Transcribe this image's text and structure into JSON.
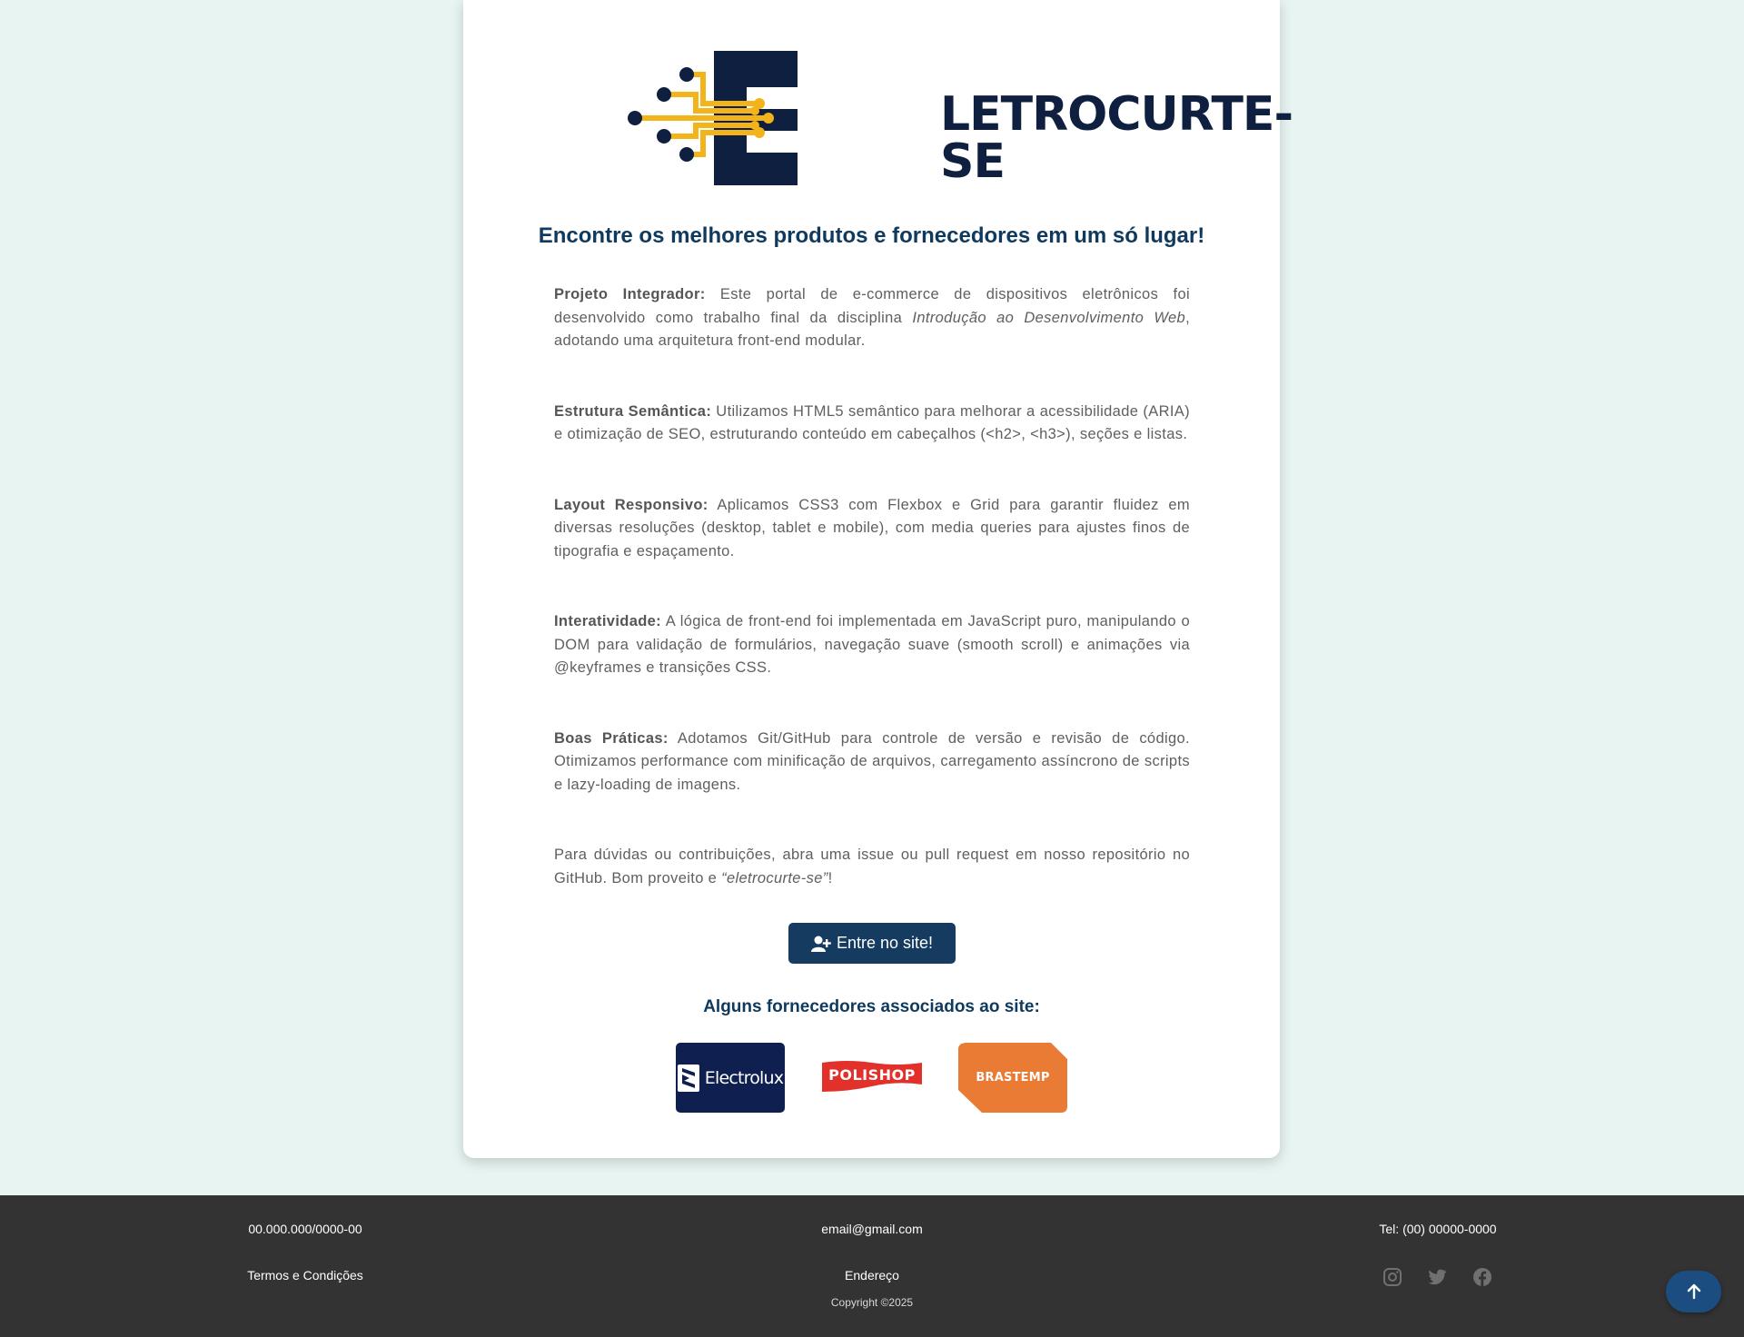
{
  "logo": {
    "text": "LETROCURTE-SE"
  },
  "headline": "Encontre os melhores produtos e fornecedores em um só lugar!",
  "paragraphs": {
    "p1": {
      "label": "Projeto Integrador:",
      "t1": " Este portal de e-commerce de dispositivos eletrônicos foi desenvolvido como trabalho final da disciplina ",
      "em": "Introdução ao Desenvolvimento Web",
      "t2": ", adotando uma arquitetura front-end modular."
    },
    "p2": {
      "label": "Estrutura Semântica:",
      "t1": " Utilizamos HTML5 semântico para melhorar a acessibilidade (ARIA) e otimização de SEO, estruturando conteúdo em cabeçalhos (<h2>, <h3>), seções e listas."
    },
    "p3": {
      "label": "Layout Responsivo:",
      "t1": " Aplicamos CSS3 com Flexbox e Grid para garantir fluidez em diversas resoluções (desktop, tablet e mobile), com media queries para ajustes finos de tipografia e espaçamento."
    },
    "p4": {
      "label": "Interatividade:",
      "t1": " A lógica de front-end foi implementada em JavaScript puro, manipulando o DOM para validação de formulários, navegação suave (smooth scroll) e animações via @keyframes e transições CSS."
    },
    "p5": {
      "label": "Boas Práticas:",
      "t1": " Adotamos Git/GitHub para controle de versão e revisão de código. Otimizamos performance com minificação de arquivos, carregamento assíncrono de scripts e lazy-loading de imagens."
    },
    "p6": {
      "t1": "Para dúvidas ou contribuições, abra uma issue ou pull request em nosso repositório no GitHub. Bom proveito e ",
      "em": "“eletrocurte-se”",
      "t2": "!"
    }
  },
  "enter_button": {
    "label": "Entre no site!",
    "icon": "user-plus-icon"
  },
  "suppliers": {
    "title": "Alguns fornecedores associados ao site:",
    "items": [
      {
        "name": "Electrolux",
        "color": "#0f1f4f"
      },
      {
        "name": "POLISHOP",
        "color": "#e2312a"
      },
      {
        "name": "BRASTEMP",
        "color": "#ea7b35"
      }
    ]
  },
  "footer": {
    "cnpj": "00.000.000/0000-00",
    "email": "email@gmail.com",
    "phone": "Tel: (00) 00000-0000",
    "terms": "Termos e Condições",
    "address": "Endereço",
    "copyright": "Copyright ©2025",
    "social": [
      "instagram-icon",
      "twitter-icon",
      "facebook-icon"
    ]
  },
  "back_to_top": {
    "icon": "arrow-up-icon"
  },
  "colors": {
    "navy": "#0f1f3f",
    "accent": "#f3b41b",
    "heading": "#0f3a5e",
    "button": "#153b60",
    "footer": "#333333"
  }
}
